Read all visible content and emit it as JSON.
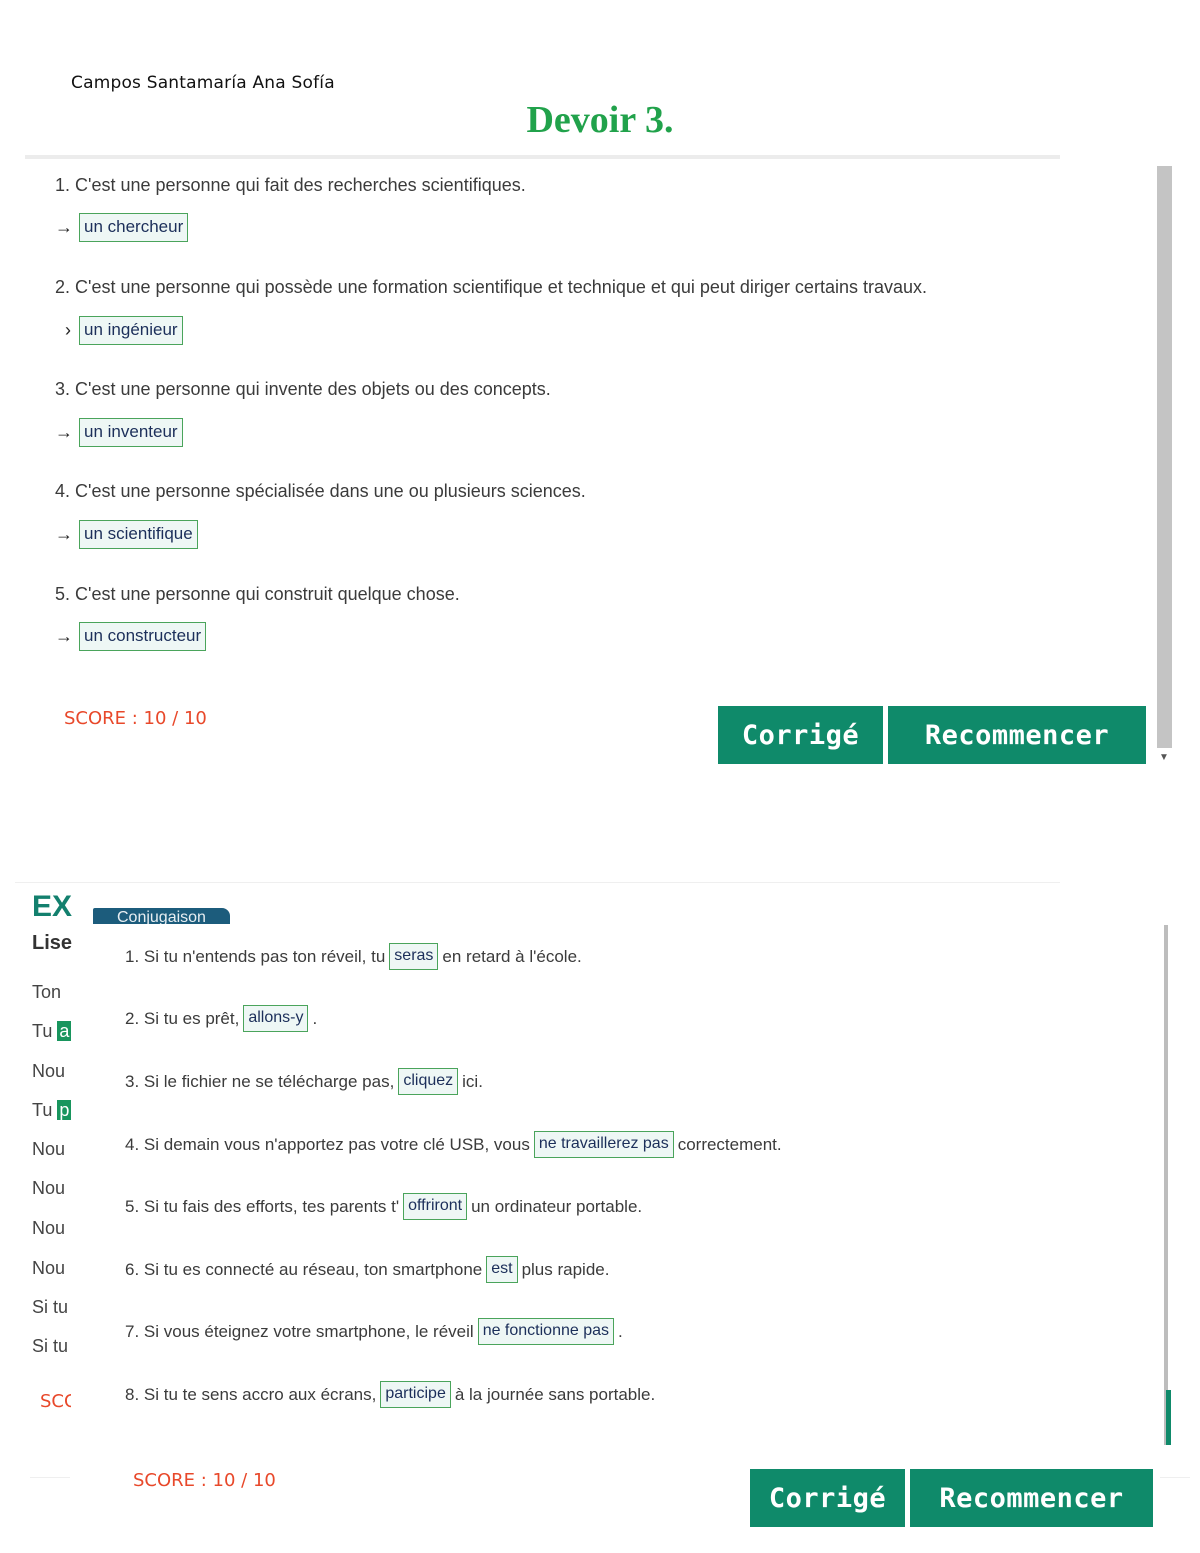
{
  "student_name": "Campos Santamaría Ana Sofía",
  "title": "Devoir 3.",
  "part1": {
    "questions": [
      {
        "number": "1.",
        "text": "C'est une personne qui fait des recherches scientifiques.",
        "arrow": "→",
        "answer": "un chercheur"
      },
      {
        "number": "2.",
        "text": "C'est une personne qui possède une formation scientifique et technique et qui peut diriger certains travaux.",
        "arrow": "›",
        "answer": "un ingénieur"
      },
      {
        "number": "3.",
        "text": "C'est une personne qui invente des objets ou des concepts.",
        "arrow": "→",
        "answer": "un inventeur"
      },
      {
        "number": "4.",
        "text": "C'est une personne spécialisée dans une ou plusieurs sciences.",
        "arrow": "→",
        "answer": "un scientifique"
      },
      {
        "number": "5.",
        "text": "C'est une personne qui construit quelque chose.",
        "arrow": "→",
        "answer": "un constructeur"
      }
    ],
    "score": "SCORE : 10 / 10",
    "correct_button": "Corrigé",
    "restart_button": "Recommencer"
  },
  "part2": {
    "ex_title": "EX",
    "lise_label": "Lise",
    "tag_label": "Conjugaison",
    "left_fragments": [
      "Ton",
      "Tu",
      "Nou",
      "Tu",
      "Nou",
      "Nou",
      "Nou",
      "Nou",
      "Si tu",
      "Si tu"
    ],
    "left_highlights": [
      "a",
      "p"
    ],
    "left_score_fragment": "SCC",
    "sentences": [
      {
        "before": "1. Si tu n'entends pas ton réveil, tu",
        "answer": "seras",
        "after": "en retard à l'école."
      },
      {
        "before": "2. Si tu es prêt,",
        "answer": "allons-y",
        "after": "."
      },
      {
        "before": "3. Si le fichier ne se télécharge pas,",
        "answer": "cliquez",
        "after": "ici."
      },
      {
        "before": "4. Si demain vous n'apportez pas votre clé USB, vous",
        "answer": "ne travaillerez pas",
        "after": "correctement."
      },
      {
        "before": "5. Si tu fais des efforts, tes parents t'",
        "answer": "offriront",
        "after": "un ordinateur portable."
      },
      {
        "before": "6. Si tu es connecté au réseau, ton smartphone",
        "answer": "est",
        "after": "plus rapide."
      },
      {
        "before": "7. Si vous éteignez votre smartphone, le réveil",
        "answer": "ne fonctionne pas",
        "after": "."
      },
      {
        "before": "8. Si tu te sens accro aux écrans,",
        "answer": "participe",
        "after": "à la journée sans portable."
      }
    ],
    "score": "SCORE : 10 / 10",
    "correct_button": "Corrigé",
    "restart_button": "Recommencer"
  },
  "colors": {
    "title_green": "#21a24b",
    "button_teal": "#0f8a6a",
    "score_red": "#e8482a",
    "answer_border": "#4aa45b",
    "tag_blue": "#1c5c7c"
  },
  "icons": {
    "scroll_down": "caret-down-icon"
  }
}
